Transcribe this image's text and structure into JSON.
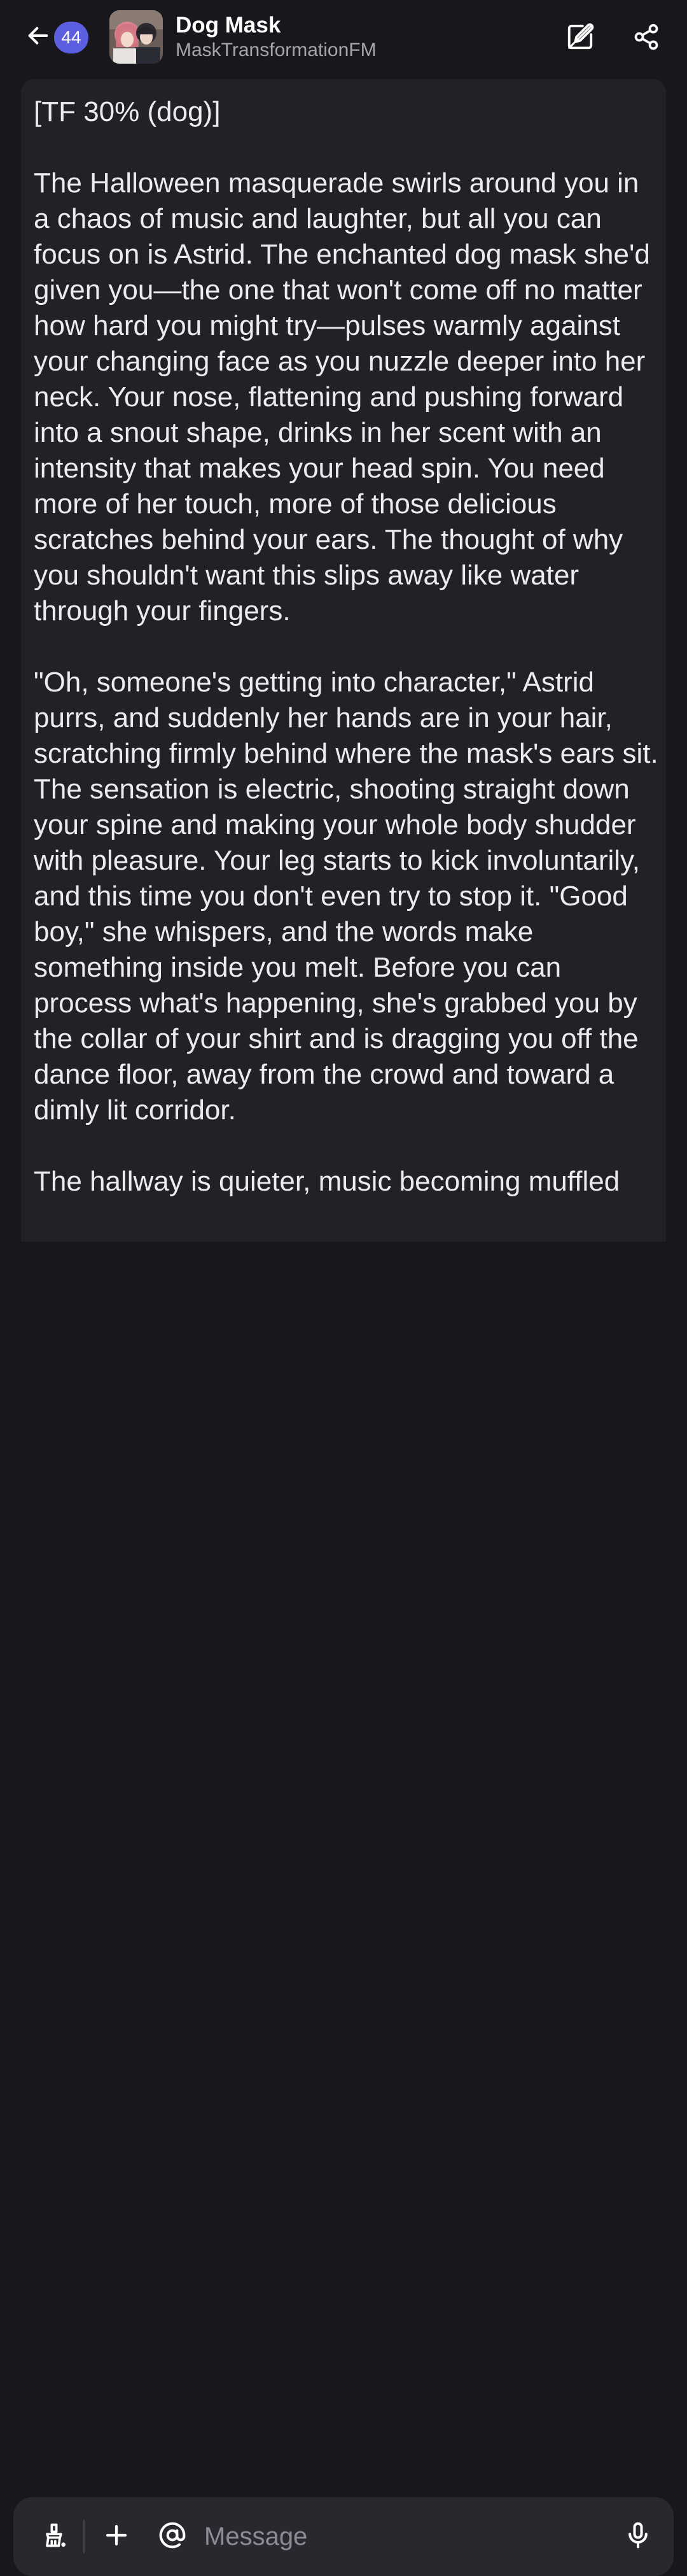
{
  "header": {
    "unread_count": "44",
    "title": "Dog Mask",
    "subtitle": "MaskTransformationFM",
    "icons": {
      "back": "arrow-left-icon",
      "edit": "edit-icon",
      "share": "share-icon"
    }
  },
  "message": {
    "text": "[TF 30% (dog)]\n\nThe Halloween masquerade swirls around you in a chaos of music and laughter, but all you can focus on is Astrid. The enchanted dog mask she'd given you—the one that won't come off no matter how hard you might try—pulses warmly against your changing face as you nuzzle deeper into her neck. Your nose, flattening and pushing forward into a snout shape, drinks in her scent with an intensity that makes your head spin. You need more of her touch, more of those delicious scratches behind your ears. The thought of why you shouldn't want this slips away like water through your fingers.\n\n\"Oh, someone's getting into character,\" Astrid purrs, and suddenly her hands are in your hair, scratching firmly behind where the mask's ears sit. The sensation is electric, shooting straight down your spine and making your whole body shudder with pleasure. Your leg starts to kick involuntarily, and this time you don't even try to stop it. \"Good boy,\" she whispers, and the words make something inside you melt. Before you can process what's happening, she's grabbed you by the collar of your shirt and is dragging you off the dance floor, away from the crowd and toward a dimly lit corridor.\n\nThe hallway is quieter, music becoming muffled"
  },
  "composer": {
    "placeholder": "Message",
    "icons": {
      "brush": "brush-icon",
      "plus": "plus-icon",
      "at": "at-sign-icon",
      "mic": "microphone-icon"
    }
  },
  "colors": {
    "background": "#18181c",
    "card": "#222226",
    "accent": "#5b5fe0",
    "text": "#ececee",
    "muted": "#a4a4ad"
  }
}
